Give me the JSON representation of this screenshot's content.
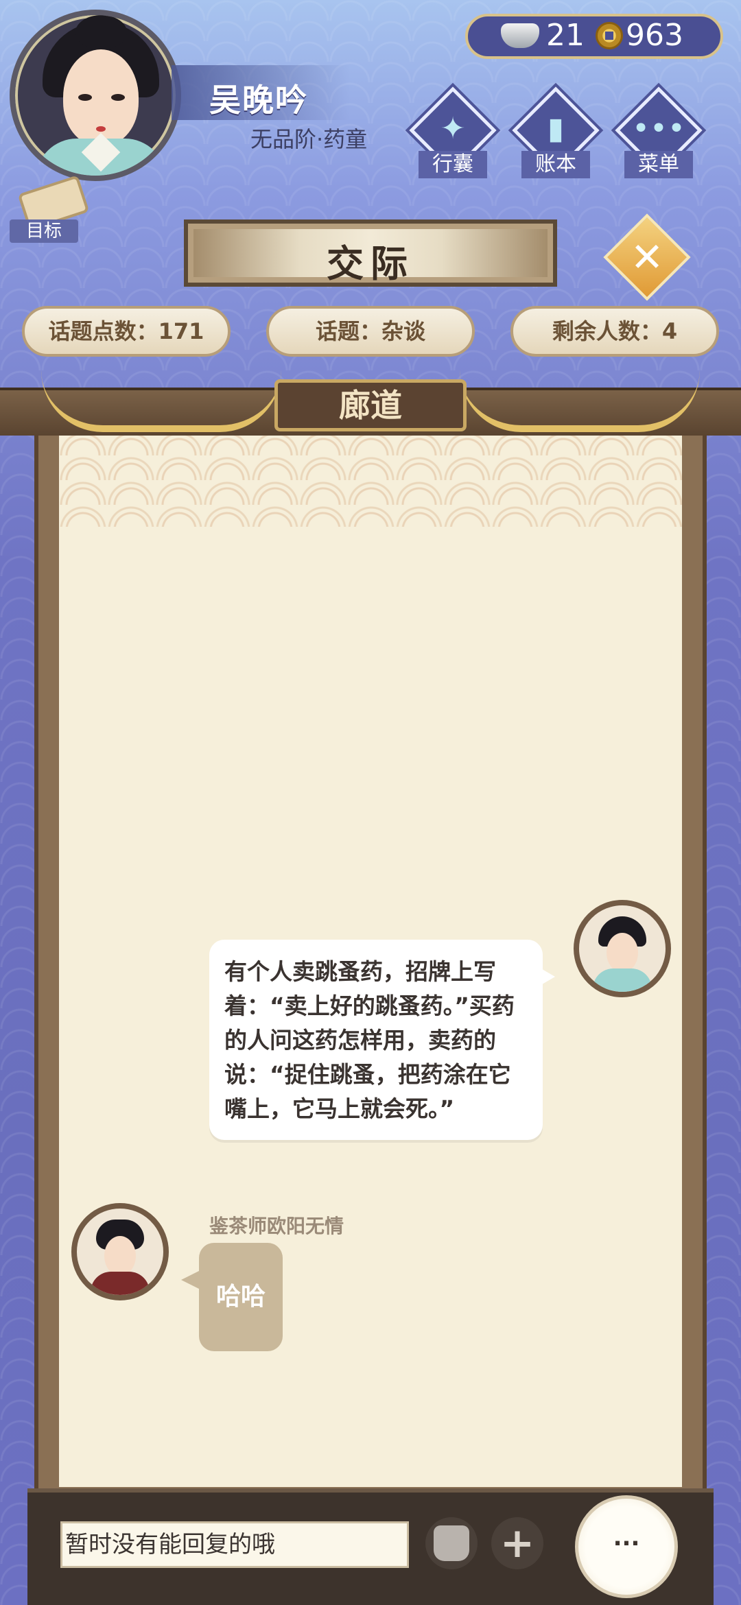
{
  "player": {
    "name": "吴晚吟",
    "rank": "无品阶·药童",
    "goal_label": "目标"
  },
  "currency": {
    "silver": "21",
    "copper": "963"
  },
  "menu": [
    {
      "label": "行囊",
      "icon": "pouch-icon"
    },
    {
      "label": "账本",
      "icon": "ledger-icon"
    },
    {
      "label": "菜单",
      "icon": "more-menu-icon"
    }
  ],
  "screen": {
    "title": "交际",
    "location": "廊道"
  },
  "info": {
    "topic_points": "话题点数：171",
    "topic": "话题：杂谈",
    "remaining": "剩余人数：4"
  },
  "chat": {
    "player_message": "有个人卖跳蚤药，招牌上写着：“卖上好的跳蚤药。”买药的人问这药怎样用，卖药的说：“捉住跳蚤，把药涂在它嘴上，它马上就会死。”",
    "npc_name": "鉴茶师欧阳无情",
    "npc_message": "哈哈"
  },
  "input": {
    "placeholder": "暂时没有能回复的哦",
    "more_label": "..."
  }
}
